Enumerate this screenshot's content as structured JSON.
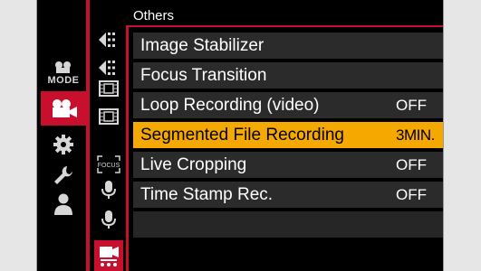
{
  "section_title": "Others",
  "mode_label": "MODE",
  "main_tabs": [
    {
      "icon": "movie-mode-icon",
      "selected": false
    },
    {
      "icon": "video-camera-icon",
      "selected": true
    },
    {
      "icon": "gear-icon",
      "selected": false
    },
    {
      "icon": "wrench-icon",
      "selected": false
    },
    {
      "icon": "person-icon",
      "selected": false
    }
  ],
  "sub_tabs": [
    {
      "icon": "image-quality-icon"
    },
    {
      "icon": "image-quality-icon"
    },
    {
      "icon": "film-strip-icon"
    },
    {
      "icon": "film-strip-icon"
    },
    {
      "icon": "focus-icon",
      "label": "FOCUS"
    },
    {
      "icon": "microphone-icon"
    },
    {
      "icon": "microphone-icon"
    },
    {
      "icon": "video-camera-others-icon",
      "selected": true
    }
  ],
  "menu_items": [
    {
      "label": "Image Stabilizer",
      "value": ""
    },
    {
      "label": "Focus Transition",
      "value": ""
    },
    {
      "label": "Loop Recording (video)",
      "value": "OFF"
    },
    {
      "label": "Segmented File Recording",
      "value": "3MIN.",
      "selected": true
    },
    {
      "label": "Live Cropping",
      "value": "OFF"
    },
    {
      "label": "Time Stamp Rec.",
      "value": "OFF"
    },
    {
      "label": "",
      "value": ""
    }
  ],
  "colors": {
    "accent": "#c8102e",
    "highlight": "#f5a800",
    "row_bg": "#2b2b2b",
    "screen_bg": "#000000"
  }
}
